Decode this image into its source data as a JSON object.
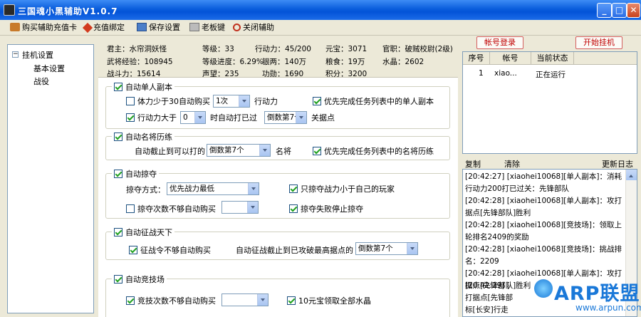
{
  "window": {
    "title": "三国魂小黑辅助V1.0.7"
  },
  "toolbar": {
    "buy_card": "购买辅助充值卡",
    "recharge_bind": "充值绑定",
    "save_settings": "保存设置",
    "boss_key": "老板键",
    "close_helper": "关闭辅助"
  },
  "tree": {
    "root": "挂机设置",
    "children": [
      "基本设置",
      "战役"
    ],
    "expander": "−"
  },
  "info": {
    "lord": "君主：水帘洞妖怪",
    "level": "等级：33",
    "stamina": "行动力：45/200",
    "yuanbao": "元宝：3071",
    "rank": "官职：破贼校尉(2级)",
    "exp": "武将经验：108945",
    "progress": "等级进度：6.29%",
    "silver": "银两：140万",
    "food": "粮食：19万",
    "crystal": "水晶：2602",
    "power": "战斗力：15614",
    "prestige": "声望：235",
    "merit": "功勋：1690",
    "points": "积分：3200"
  },
  "groups": {
    "single_dungeon": {
      "title": "自动单人副本",
      "buy_label": "体力少于30自动购买",
      "buy_select": "1次",
      "buy_suffix": "行动力",
      "priority_label": "优先完成任务列表中的单人副本",
      "stamina_label": "行动力大于",
      "stamina_select": "0",
      "stamina_mid": "时自动打已过",
      "stage_select": "倒数第7个",
      "stage_suffix": "关据点"
    },
    "general_training": {
      "title": "自动名将历练",
      "until_label": "自动截止到可以打的",
      "until_select": "倒数第7个",
      "until_suffix": "名将",
      "priority_label": "优先完成任务列表中的名将历练"
    },
    "plunder": {
      "title": "自动掠夺",
      "mode_label": "掠夺方式：",
      "mode_select": "优先战力最低",
      "only_weaker_label": "只掠夺战力小于自己的玩家",
      "buy_label": "掠夺次数不够自动购买",
      "buy_select": "",
      "stop_label": "掠夺失败停止掠夺"
    },
    "conquest": {
      "title": "自动征战天下",
      "buy_label": "征战令不够自动购买",
      "until_label": "自动征战截止到已攻破最高据点的",
      "until_select": "倒数第7个"
    },
    "arena": {
      "title": "自动竞技场",
      "buy_label": "竞技次数不够自动购买",
      "buy_select": "",
      "crystal_label": "10元宝领取全部水晶"
    }
  },
  "actions": {
    "login": "帐号登录",
    "start": "开始挂机"
  },
  "accounts": {
    "headers": [
      "序号",
      "帐号",
      "当前状态"
    ],
    "rows": [
      {
        "index": "1",
        "account": "xiao...",
        "status": "正在运行"
      }
    ]
  },
  "log": {
    "copy": "复制",
    "clear": "清除",
    "update": "更新日志",
    "lines": [
      "[20:42:27] [xiaohei10068][单人副本]：消耗行动力200打已过关：先锋部队",
      "[20:42:28] [xiaohei10068][单人副本]：攻打据点[先锋部队]胜利",
      "[20:42:28] [xiaohei10068][竞技场]：领取上轮排名2409的奖励",
      "[20:42:28] [xiaohei10068][竞技场]：挑战排名：2209",
      "[20:42:28] [xiaohei10068][单人副本]：攻打据点[先锋部队]胜利",
      "[20:42:29] [",
      "打据点[先锋部",
      "标[长安]行走"
    ]
  },
  "watermark": {
    "logo": "ARP联盟",
    "url": "www.arpun.com"
  }
}
